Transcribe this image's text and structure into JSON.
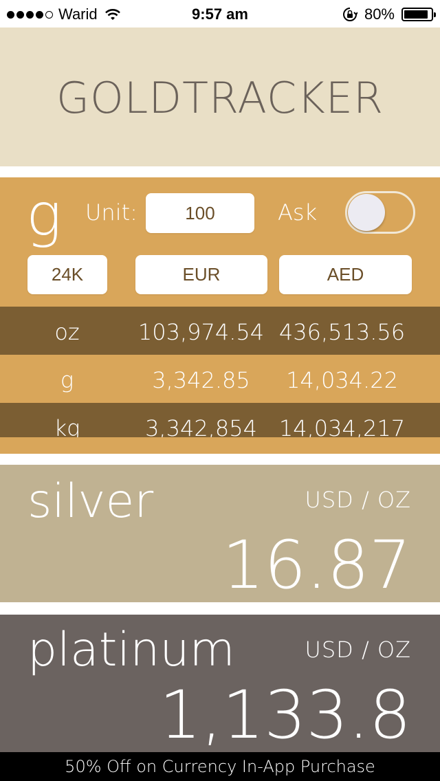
{
  "status_bar": {
    "carrier": "Warid",
    "time": "9:57 am",
    "battery": "80%",
    "battery_level": 0.8,
    "signal_bars_filled": 4,
    "icons": [
      "signal-dots-icon",
      "wifi-icon",
      "rotation-lock-icon",
      "battery-icon"
    ]
  },
  "header": {
    "title": "GOLDTRACKER"
  },
  "gold": {
    "unit_symbol": "g",
    "unit_label": "Unit:",
    "unit_value": "100",
    "ask_label": "Ask",
    "ask_toggle_on": false,
    "karat_button": "24K",
    "currency1_button": "EUR",
    "currency2_button": "AED",
    "rows": [
      {
        "unit": "oz",
        "value1": "103,974.54",
        "value2": "436,513.56"
      },
      {
        "unit": "g",
        "value1": "3,342.85",
        "value2": "14,034.22"
      },
      {
        "unit": "kg",
        "value1": "3,342,854",
        "value2": "14,034,217"
      }
    ]
  },
  "silver": {
    "name": "silver",
    "unit": "USD / OZ",
    "price": "16.87"
  },
  "platinum": {
    "name": "platinum",
    "unit": "USD / OZ",
    "price": "1,133.8"
  },
  "footer": {
    "text": "50% Off on Currency In-App Purchase"
  },
  "colors": {
    "header_bg": "#e9dfc6",
    "gold_bg": "#d9a65a",
    "gold_dark_row": "#7b5e33",
    "silver_bg": "#c0b292",
    "platinum_bg": "#6b6360",
    "footer_bg": "#000000"
  }
}
